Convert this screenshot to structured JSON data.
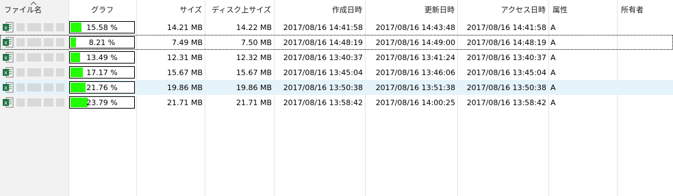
{
  "header": {
    "name": "ファイル名",
    "graph": "グラフ",
    "size": "サイズ",
    "disk_size": "ディスク上サイズ",
    "created": "作成日時",
    "modified": "更新日時",
    "accessed": "アクセス日時",
    "attributes": "属性",
    "owner": "所有者"
  },
  "rows": [
    {
      "percent": 15.58,
      "graph_label": "15.58 %",
      "size": "14.21 MB",
      "disk_size": "14.22 MB",
      "created": "2017/08/16 14:41:58",
      "modified": "2017/08/16 14:43:48",
      "accessed": "2017/08/16 14:41:58",
      "attributes": "A"
    },
    {
      "percent": 8.21,
      "graph_label": "8.21 %",
      "size": "7.49 MB",
      "disk_size": "7.50 MB",
      "created": "2017/08/16 14:48:19",
      "modified": "2017/08/16 14:49:00",
      "accessed": "2017/08/16 14:48:19",
      "attributes": "A"
    },
    {
      "percent": 13.49,
      "graph_label": "13.49 %",
      "size": "12.31 MB",
      "disk_size": "12.32 MB",
      "created": "2017/08/16 13:40:37",
      "modified": "2017/08/16 13:41:24",
      "accessed": "2017/08/16 13:40:37",
      "attributes": "A"
    },
    {
      "percent": 17.17,
      "graph_label": "17.17 %",
      "size": "15.67 MB",
      "disk_size": "15.67 MB",
      "created": "2017/08/16 13:45:04",
      "modified": "2017/08/16 13:46:06",
      "accessed": "2017/08/16 13:45:04",
      "attributes": "A"
    },
    {
      "percent": 21.76,
      "graph_label": "21.76 %",
      "size": "19.86 MB",
      "disk_size": "19.86 MB",
      "created": "2017/08/16 13:50:38",
      "modified": "2017/08/16 13:51:38",
      "accessed": "2017/08/16 13:50:38",
      "attributes": "A"
    },
    {
      "percent": 23.79,
      "graph_label": "23.79 %",
      "size": "21.71 MB",
      "disk_size": "21.71 MB",
      "created": "2017/08/16 13:58:42",
      "modified": "2017/08/16 14:00:25",
      "accessed": "2017/08/16 13:58:42",
      "attributes": "A"
    }
  ],
  "colors": {
    "bar_fill": "#22ff00",
    "selected_row": "#e5f3fb",
    "sorted_column": "#f2f2f2",
    "excel_icon": "#1f7244"
  },
  "icons": {
    "file": "excel-file-icon",
    "sort": "sort-ascending-icon"
  },
  "state": {
    "selected_row": 4,
    "focused_row": 1
  }
}
